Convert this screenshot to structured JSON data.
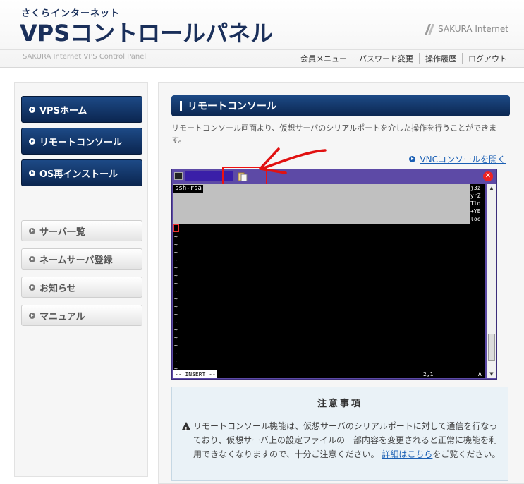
{
  "header": {
    "brand_small": "さくらインターネット",
    "brand_main": "VPSコントロールパネル",
    "logo_text": "SAKURA Internet",
    "subtitle": "SAKURA Internet VPS Control Panel",
    "nav": [
      "会員メニュー",
      "パスワード変更",
      "操作履歴",
      "ログアウト"
    ]
  },
  "sidebar": {
    "primary": [
      "VPSホーム",
      "リモートコンソール",
      "OS再インストール"
    ],
    "secondary": [
      "サーバ一覧",
      "ネームサーバ登録",
      "お知らせ",
      "マニュアル"
    ]
  },
  "main": {
    "title": "リモートコンソール",
    "description": "リモートコンソール画面より、仮想サーバのシリアルポートを介した操作を行うことができます。",
    "vnc_link": "VNCコンソールを開く"
  },
  "console": {
    "ssh_label": "ssh-rsa",
    "right_text": [
      "j3z",
      "yrZ",
      "Tld",
      "+YE",
      "loc"
    ],
    "status_mode": "-- INSERT --",
    "status_pos": "2,1",
    "status_all": "A",
    "close_glyph": "✕"
  },
  "notes": {
    "title": "注意事項",
    "body": "リモートコンソール機能は、仮想サーバのシリアルポートに対して通信を行なっており、仮想サーバ上の設定ファイルの一部内容を変更されると正常に機能を利用できなくなりますので、十分ご注意ください。",
    "link": "詳細はこちら",
    "tail": "をご覧ください。"
  },
  "colors": {
    "navy": "#0b2650",
    "accent_link": "#1a5fb4",
    "annotation_red": "#e11111"
  }
}
